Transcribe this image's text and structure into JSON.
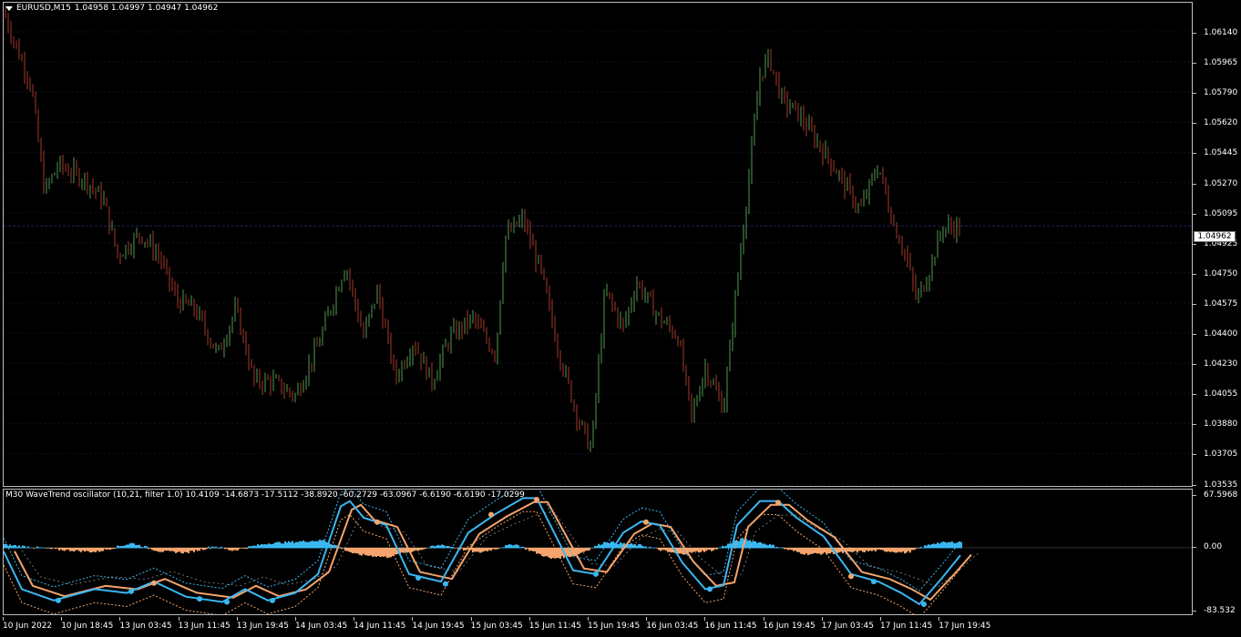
{
  "chart": {
    "symbol_label": "EURUSD,M15",
    "ohlc": "1.04958 1.04997 1.04947 1.04962",
    "current_price": "1.04962",
    "price_axis": [
      "1.06140",
      "1.05965",
      "1.05790",
      "1.05620",
      "1.05445",
      "1.05270",
      "1.05095",
      "1.04925",
      "1.04750",
      "1.04575",
      "1.04400",
      "1.04230",
      "1.04055",
      "1.03880",
      "1.03705",
      "1.03535"
    ],
    "colors": {
      "background": "#000000",
      "bull": "#4f9a4f",
      "bear": "#a33a2a",
      "grid": "#2a2a3a",
      "price_line": "#232360"
    }
  },
  "oscillator": {
    "title": "M30 WaveTrend oscillator (10,21, filter 1.0) 10.4109 -14.6873 -17.5112 -38.8920 -60.2729 -63.0967 -6.6190 -6.6190 -17.0299",
    "axis": [
      "67.5968",
      "0.00",
      "-83.532"
    ],
    "colors": {
      "wt1": "#3ab7f0",
      "wt2": "#f4a46c",
      "histo_pos": "#3ab7f0",
      "histo_neg": "#f4a46c"
    }
  },
  "time_axis": [
    "10 Jun 2022",
    "10 Jun 18:45",
    "13 Jun 03:45",
    "13 Jun 11:45",
    "13 Jun 19:45",
    "14 Jun 03:45",
    "14 Jun 11:45",
    "14 Jun 19:45",
    "15 Jun 03:45",
    "15 Jun 11:45",
    "15 Jun 19:45",
    "16 Jun 03:45",
    "16 Jun 11:45",
    "16 Jun 19:45",
    "17 Jun 03:45",
    "17 Jun 11:45",
    "17 Jun 19:45"
  ]
}
